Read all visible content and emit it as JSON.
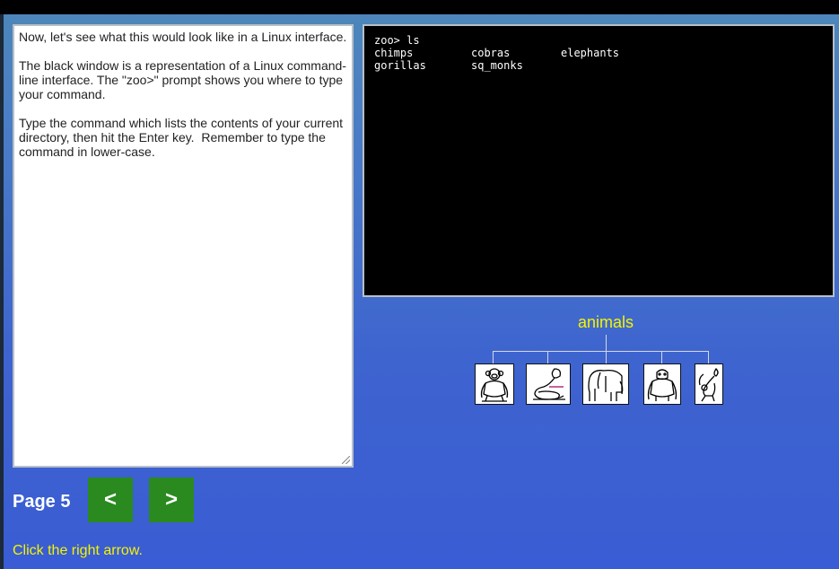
{
  "instructions": {
    "paragraphs": [
      "Now, let's see what this would look like in a Linux interface.",
      "The black window is a representation of a Linux command-line interface. The \"zoo>\" prompt shows you where to type your command.",
      "Type the command which lists the contents of your current directory, then hit the Enter key.  Remember to type the command in lower-case."
    ]
  },
  "terminal": {
    "command_line": "zoo> ls",
    "listing": [
      [
        "chimps",
        "cobras",
        "elephants"
      ],
      [
        "gorillas",
        "sq_monks",
        ""
      ]
    ]
  },
  "tree": {
    "root_label": "animals",
    "children": [
      {
        "name": "chimps",
        "icon": "chimp-icon"
      },
      {
        "name": "cobras",
        "icon": "cobra-icon"
      },
      {
        "name": "elephants",
        "icon": "elephant-icon"
      },
      {
        "name": "gorillas",
        "icon": "gorilla-icon"
      },
      {
        "name": "sq_monks",
        "icon": "squirrel-monkey-icon"
      }
    ]
  },
  "navigation": {
    "page_label": "Page 5",
    "prev_label": "<",
    "next_label": ">",
    "hint": "Click the right arrow."
  },
  "colors": {
    "accent_yellow": "#f4f400",
    "button_green": "#2a8a1f",
    "terminal_bg": "#000000"
  }
}
